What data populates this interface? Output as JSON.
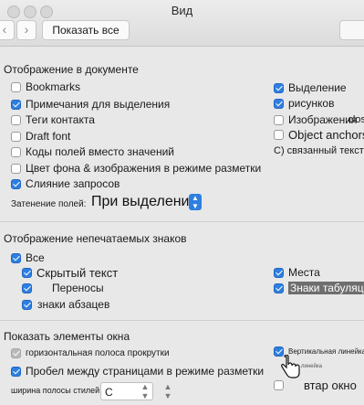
{
  "window": {
    "title": "Вид",
    "show_all": "Показать все",
    "back": "‹",
    "forward": "›"
  },
  "sections": {
    "document": "Отображение в документе",
    "nonprinting": "Отображение непечатаемых знаков",
    "window_elements": "Показать элементы окна"
  },
  "document_left": [
    {
      "label": "Bookmarks",
      "checked": false
    },
    {
      "label": "Примечания для выделения",
      "checked": true
    },
    {
      "label": "Теги контакта",
      "checked": false
    },
    {
      "label": "Draft font",
      "checked": false
    },
    {
      "label": "Коды полей вместо значений",
      "checked": false
    },
    {
      "label": "Цвет фона & изображения в режиме разметки",
      "checked": false
    },
    {
      "label": "Слияние запросов",
      "checked": true
    }
  ],
  "document_right": [
    {
      "label": "Выделение",
      "checked": true
    },
    {
      "label": "рисунков",
      "checked": true
    },
    {
      "label": "Изображения",
      "overlay": "close",
      "checked": false
    },
    {
      "label": "Object anchors",
      "checked": false
    },
    {
      "label": "С) связанный текст",
      "checked": false
    }
  ],
  "shading": {
    "label": "Затенение полей:",
    "value": "При выделении"
  },
  "nonprinting_left": [
    {
      "label": "Все",
      "checked": true
    },
    {
      "label": "Скрытый текст",
      "checked": true
    },
    {
      "label": "Переносы",
      "checked": true
    },
    {
      "label": "знаки абзацев",
      "checked": true
    }
  ],
  "nonprinting_right": [
    {
      "label": "Места",
      "checked": true
    },
    {
      "label": "Знаки табуляции",
      "checked": true
    }
  ],
  "window_left": [
    {
      "label": "горизонтальная полоса прокрутки",
      "checked": true
    },
    {
      "label": "Пробел между страницами в режиме разметки",
      "checked": true
    }
  ],
  "window_right": [
    {
      "label": "Вертикальная линейка",
      "checked": true
    },
    {
      "label": "линейка",
      "checked": false
    },
    {
      "label": "втар окно",
      "checked": false
    }
  ],
  "style_width": {
    "label": "ширина полосы стилей:",
    "value": "С"
  },
  "colors": {
    "accent": "#2e7fe0",
    "highlight": "#6e6e6e"
  }
}
